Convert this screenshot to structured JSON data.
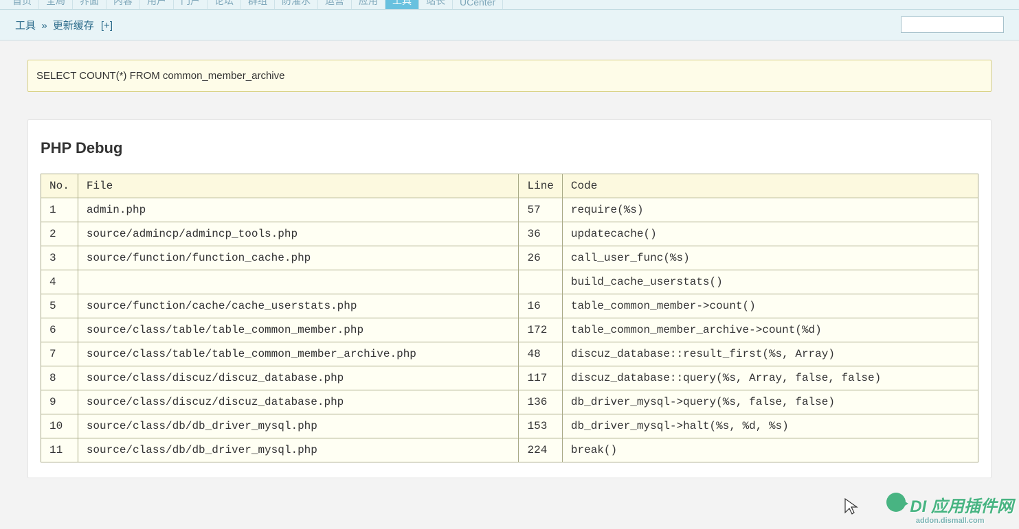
{
  "nav": {
    "tabs": [
      "首页",
      "全局",
      "界面",
      "内容",
      "用户",
      "门户",
      "论坛",
      "群组",
      "防灌水",
      "运营",
      "应用",
      "工具",
      "站长",
      "UCenter"
    ],
    "active_index": 11
  },
  "breadcrumb": {
    "root": "工具",
    "sep": "»",
    "current": "更新缓存",
    "plus": "[+]"
  },
  "search": {
    "placeholder": ""
  },
  "sql": "SELECT COUNT(*) FROM common_member_archive",
  "debug": {
    "title": "PHP Debug",
    "headers": {
      "no": "No.",
      "file": "File",
      "line": "Line",
      "code": "Code"
    },
    "rows": [
      {
        "no": "1",
        "file": "admin.php",
        "line": "57",
        "code": "require(%s)"
      },
      {
        "no": "2",
        "file": "source/admincp/admincp_tools.php",
        "line": "36",
        "code": "updatecache()"
      },
      {
        "no": "3",
        "file": "source/function/function_cache.php",
        "line": "26",
        "code": "call_user_func(%s)"
      },
      {
        "no": "4",
        "file": "",
        "line": "",
        "code": "build_cache_userstats()"
      },
      {
        "no": "5",
        "file": "source/function/cache/cache_userstats.php",
        "line": "16",
        "code": "table_common_member->count()"
      },
      {
        "no": "6",
        "file": "source/class/table/table_common_member.php",
        "line": "172",
        "code": "table_common_member_archive->count(%d)"
      },
      {
        "no": "7",
        "file": "source/class/table/table_common_member_archive.php",
        "line": "48",
        "code": "discuz_database::result_first(%s, Array)"
      },
      {
        "no": "8",
        "file": "source/class/discuz/discuz_database.php",
        "line": "117",
        "code": "discuz_database::query(%s, Array, false, false)"
      },
      {
        "no": "9",
        "file": "source/class/discuz/discuz_database.php",
        "line": "136",
        "code": "db_driver_mysql->query(%s, false, false)"
      },
      {
        "no": "10",
        "file": "source/class/db/db_driver_mysql.php",
        "line": "153",
        "code": "db_driver_mysql->halt(%s, %d, %s)"
      },
      {
        "no": "11",
        "file": "source/class/db/db_driver_mysql.php",
        "line": "224",
        "code": "break()"
      }
    ]
  },
  "watermark": {
    "main": "DI 应用插件网",
    "sub": "addon.dismall.com"
  }
}
